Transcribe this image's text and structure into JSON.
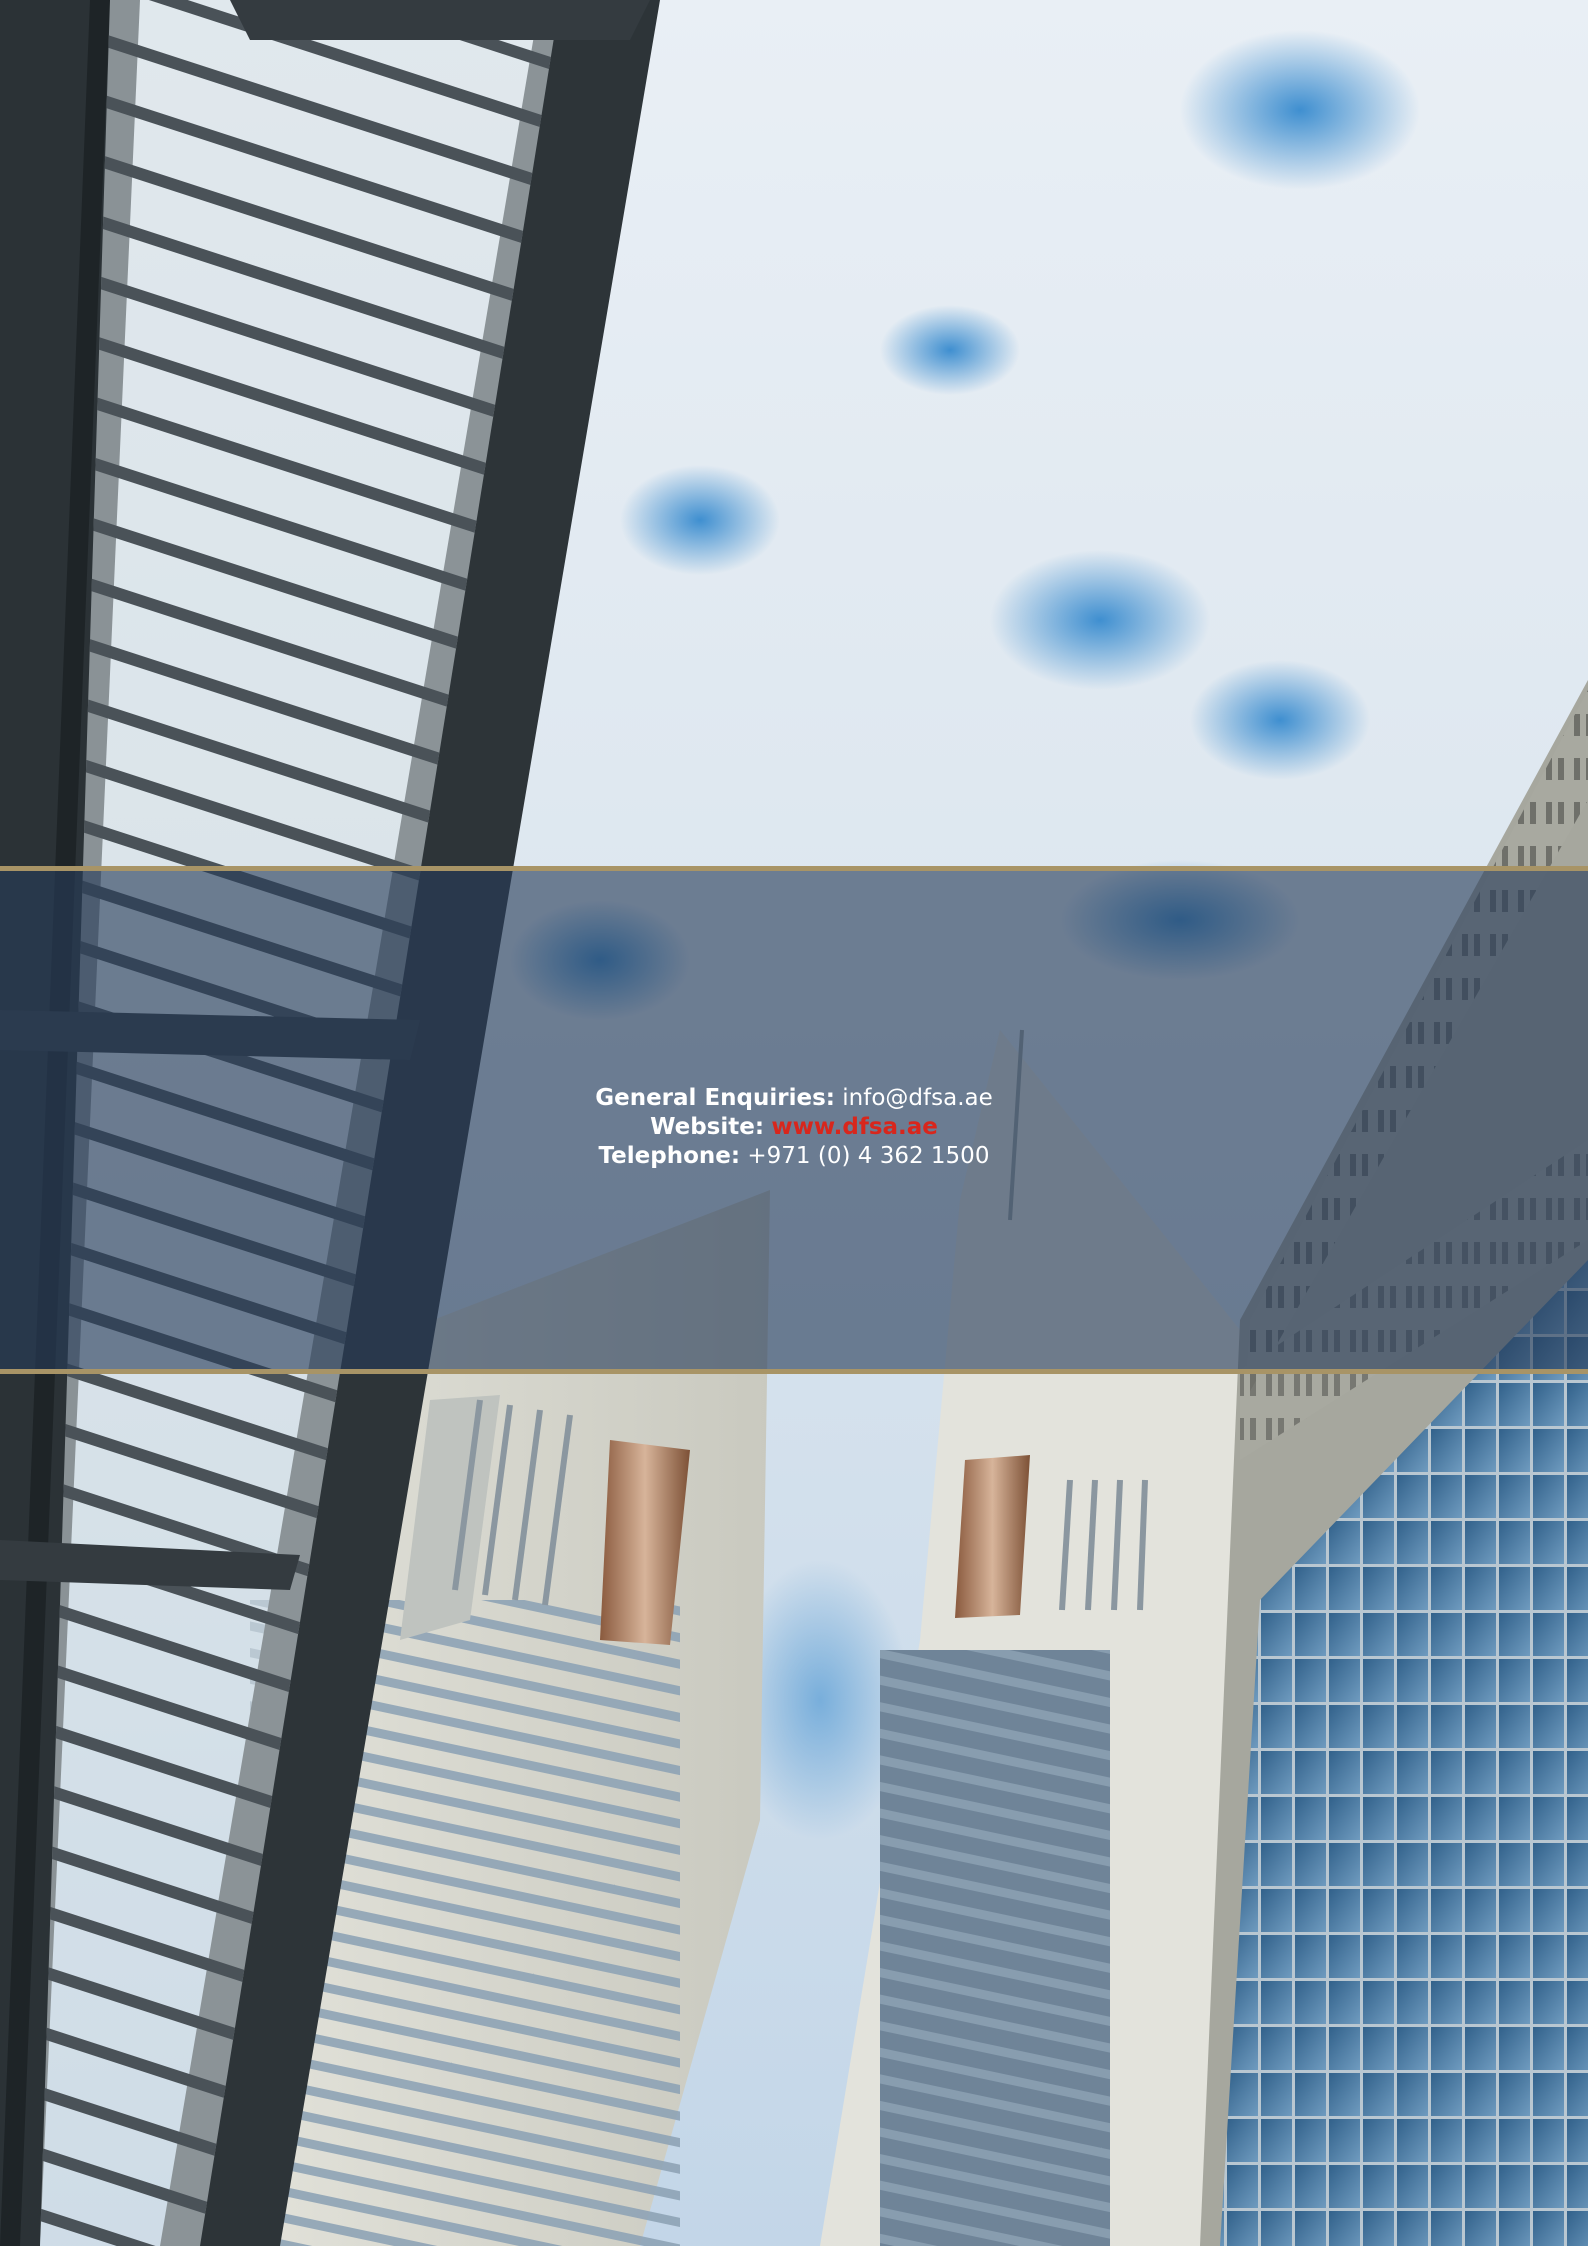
{
  "contact": {
    "general_label": "General Enquiries:",
    "general_value": "info@dfsa.ae",
    "website_label": "Website:",
    "website_value": "www.dfsa.ae",
    "telephone_label": "Telephone:",
    "telephone_value": "+971 (0) 4 362 1500"
  },
  "colors": {
    "band_overlay": "#263c58",
    "band_rule": "#a89466",
    "link": "#d8261c",
    "text": "#ffffff"
  },
  "icons": [
    "photo-background-icon"
  ]
}
